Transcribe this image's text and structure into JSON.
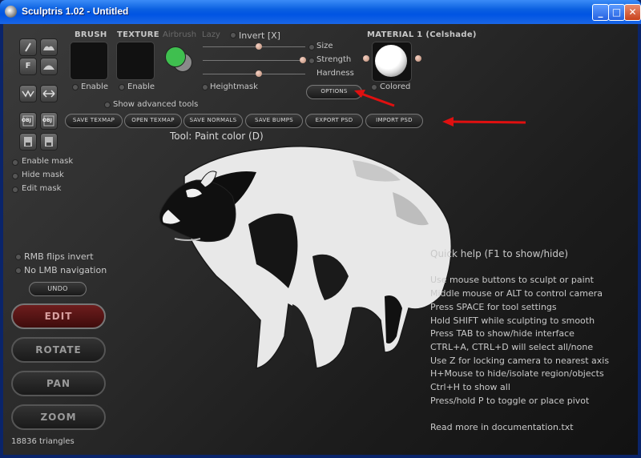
{
  "window": {
    "title": "Sculptris 1.02 - Untitled",
    "minimize_label": "_",
    "maximize_label": "□",
    "close_label": "✕"
  },
  "left_tools": {
    "icons": [
      "draw-tool-icon",
      "crease-tool-icon",
      "flatten-tool-icon",
      "inflate-tool-icon",
      "pinch-tool-icon",
      "grab-tool-icon",
      "reduce-brush-icon",
      "symmetry-icon",
      "import-obj-icon",
      "export-obj-icon",
      "save-file-icon",
      "open-file-icon"
    ],
    "flatten_label": "F",
    "import_obj_label": "OBJ",
    "export_obj_label": "OBJ"
  },
  "paint_panel": {
    "brush_label": "BRUSH",
    "texture_label": "TEXTURE",
    "airbrush_label": "Airbrush",
    "lazy_label": "Lazy",
    "invert_label": "Invert [X]",
    "brush_enable_label": "Enable",
    "texture_enable_label": "Enable",
    "heightmask_label": "Heightmask",
    "show_advanced_label": "Show advanced tools",
    "size_label": "Size",
    "strength_label": "Strength",
    "hardness_label": "Hardness",
    "size_value": 0.55,
    "strength_value": 0.98,
    "hardness_value": 0.55,
    "color_primary": "#3fbf4f",
    "color_secondary": "#8a8a8a",
    "material_label": "MATERIAL 1 (Celshade)",
    "colored_label": "Colored",
    "options_label": "OPTIONS"
  },
  "texmap_buttons": [
    "SAVE TEXMAP",
    "OPEN TEXMAP",
    "SAVE NORMALS",
    "SAVE BUMPS",
    "EXPORT PSD",
    "IMPORT PSD"
  ],
  "tool_status": "Tool: Paint color (D)",
  "mask_options": {
    "enable_mask": "Enable mask",
    "hide_mask": "Hide mask",
    "edit_mask": "Edit mask"
  },
  "nav_options": {
    "rmb_flips": "RMB flips invert",
    "no_lmb": "No LMB navigation",
    "undo_label": "UNDO"
  },
  "mode_buttons": {
    "edit": "EDIT",
    "rotate": "ROTATE",
    "pan": "PAN",
    "zoom": "ZOOM"
  },
  "triangle_count": "18836 triangles",
  "quick_help": {
    "title": "Quick help (F1 to show/hide)",
    "lines": [
      "Use mouse buttons to sculpt or paint",
      "Middle mouse or ALT to control camera",
      "Press SPACE for tool settings",
      "Hold SHIFT while sculpting to smooth",
      "Press TAB to show/hide interface",
      "CTRL+A, CTRL+D will select all/none",
      "Use Z for locking camera to nearest axis",
      "H+Mouse to hide/isolate region/objects",
      "Ctrl+H to show all",
      "Press/hold P to toggle or place pivot"
    ],
    "footer": "Read more in documentation.txt"
  },
  "annotation_color": "#e01010"
}
